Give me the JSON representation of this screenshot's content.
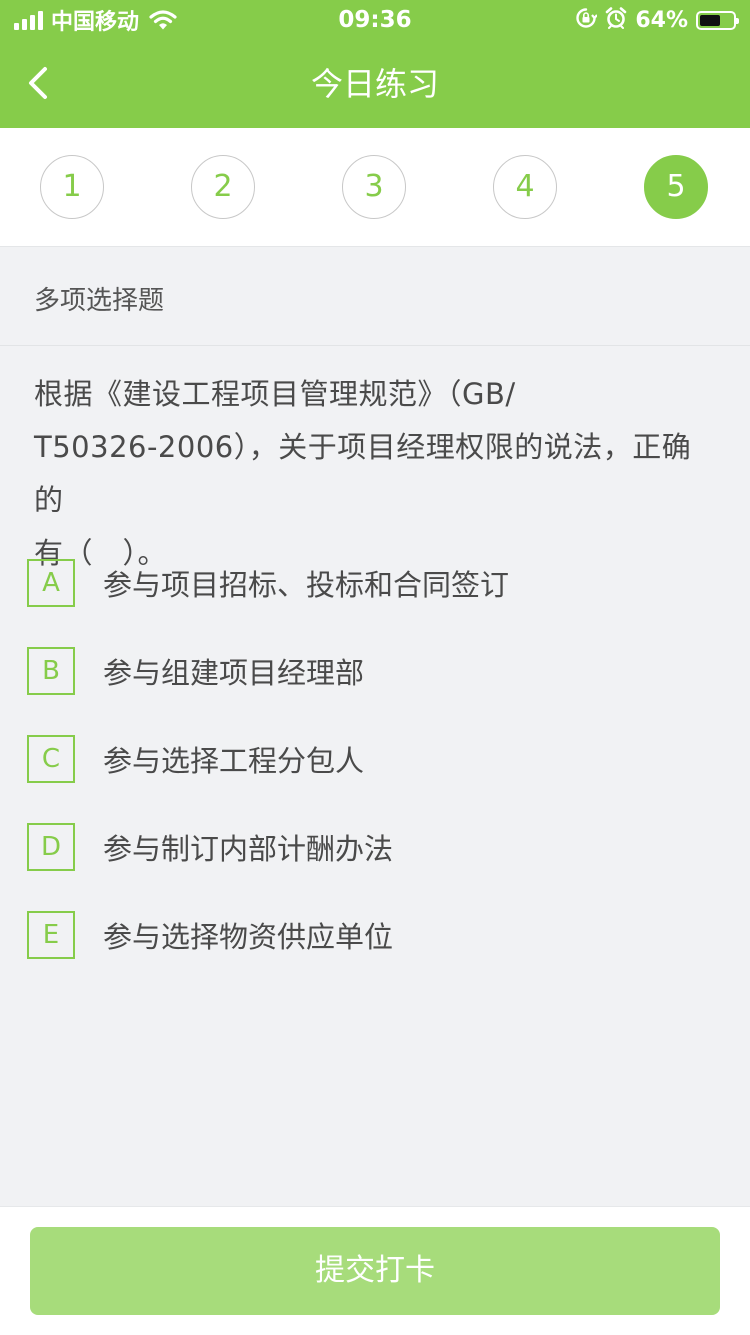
{
  "status_bar": {
    "carrier": "中国移动",
    "time": "09:36",
    "battery_percent": "64%",
    "battery_level": 0.64,
    "icons": [
      "signal-icon",
      "wifi-icon",
      "rotation-lock-icon",
      "alarm-icon",
      "battery-icon"
    ]
  },
  "nav": {
    "title": "今日练习",
    "back_icon": "chevron-left-icon"
  },
  "question_tabs": {
    "items": [
      "1",
      "2",
      "3",
      "4",
      "5"
    ],
    "active": "5"
  },
  "question": {
    "type": "多项选择题",
    "text_line1": "根据《建设工程项目管理规范》（GB/",
    "text_line2": "T50326-2006），关于项目经理权限的说法，正确的",
    "text_line3": "有（　）。",
    "options": [
      {
        "letter": "A",
        "text": "参与项目招标、投标和合同签订"
      },
      {
        "letter": "B",
        "text": "参与组建项目经理部"
      },
      {
        "letter": "C",
        "text": "参与选择工程分包人"
      },
      {
        "letter": "D",
        "text": "参与制订内部计酬办法"
      },
      {
        "letter": "E",
        "text": "参与选择物资供应单位"
      }
    ]
  },
  "footer": {
    "submit_label": "提交打卡"
  },
  "colors": {
    "accent": "#86cc4a",
    "submit_disabled": "#a7dc7b",
    "background": "#f1f2f4"
  }
}
